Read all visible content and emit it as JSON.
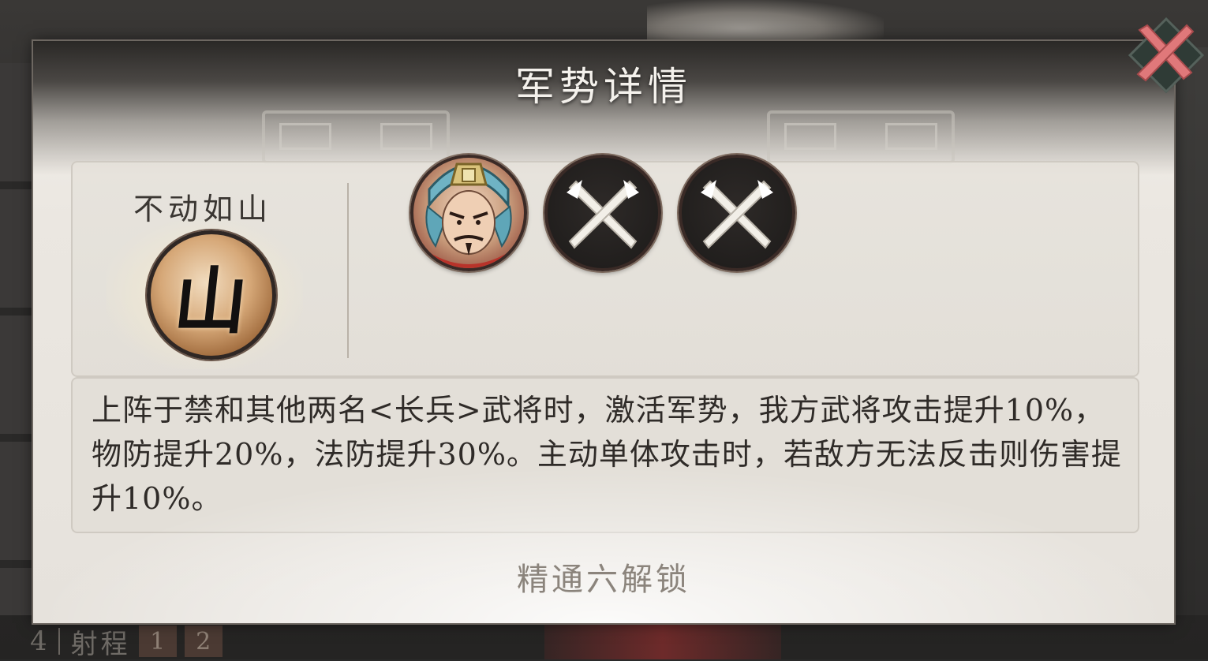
{
  "dialog": {
    "title": "军势详情",
    "close_icon": "close-x-icon"
  },
  "stance": {
    "name": "不动如山",
    "icon_glyph": "山",
    "icon": "mountain-emblem-icon"
  },
  "formation": {
    "slots": [
      {
        "type": "general",
        "icon": "general-portrait"
      },
      {
        "type": "empty",
        "icon": "crossed-blades-icon"
      },
      {
        "type": "empty",
        "icon": "crossed-blades-icon"
      }
    ]
  },
  "description": "上阵于禁和其他两名<长兵>武将时，激活军势，我方武将攻击提升10%，物防提升20%，法防提升30%。主动单体攻击时，若敌方无法反击则伤害提升10%。",
  "unlock": {
    "label": "精通六解锁"
  },
  "background_strip": {
    "index": "4",
    "label": "射程",
    "levels": [
      "1",
      "2"
    ]
  },
  "colors": {
    "title_text": "#f4f1ec",
    "body_text": "#2f2b28",
    "muted_text": "#8b847c",
    "close_red": "#e0787a",
    "panel_bg": "#ebe7e1"
  }
}
